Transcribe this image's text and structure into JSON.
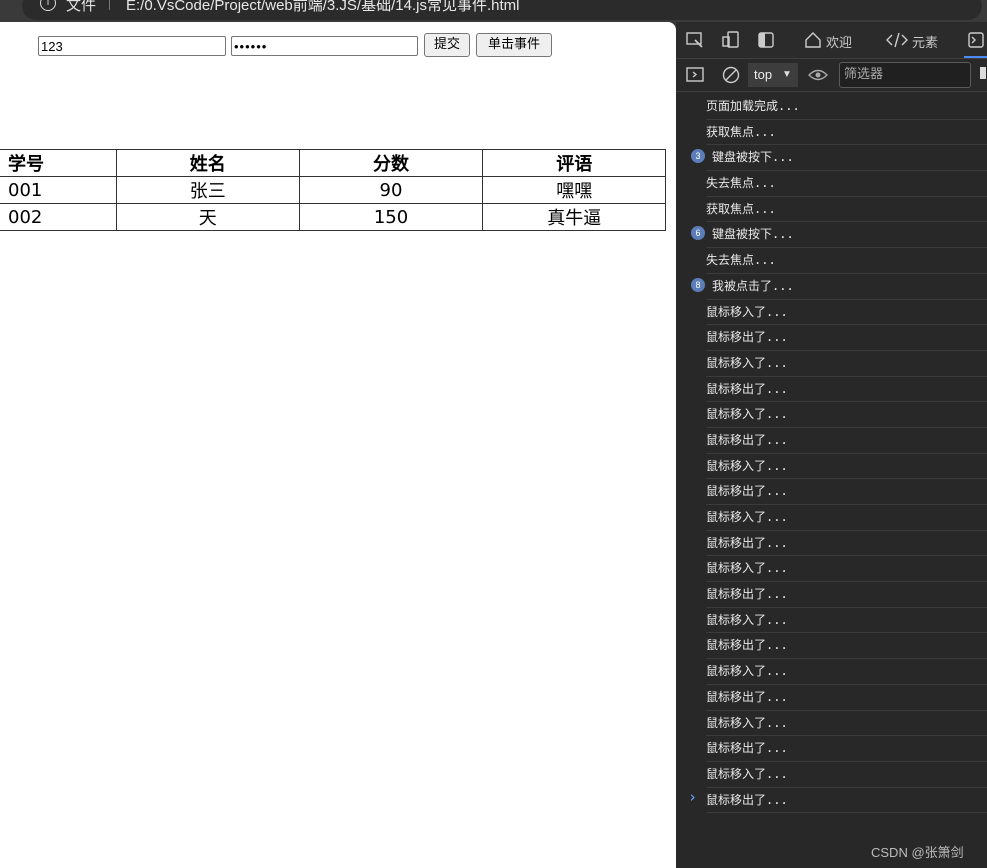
{
  "addressbar": {
    "info_icon": "i",
    "file_label": "文件",
    "url": "E:/0.VsCode/Project/web前端/3.JS/基础/14.js常见事件.html"
  },
  "page": {
    "username_value": "123",
    "password_value": "••••••",
    "submit_label": "提交",
    "click_label": "单击事件",
    "table": {
      "headers": [
        "学号",
        "姓名",
        "分数",
        "评语"
      ],
      "rows": [
        [
          "001",
          "张三",
          "90",
          "嘿嘿"
        ],
        [
          "002",
          "天",
          "150",
          "真牛逼"
        ]
      ]
    }
  },
  "devtools": {
    "tabs": {
      "welcome": "欢迎",
      "elements": "元素"
    },
    "context": "top",
    "filter_placeholder": "筛选器",
    "logs": [
      {
        "text": "页面加载完成...",
        "count": ""
      },
      {
        "text": "获取焦点...",
        "count": ""
      },
      {
        "text": "键盘被按下...",
        "count": "3"
      },
      {
        "text": "失去焦点...",
        "count": ""
      },
      {
        "text": "获取焦点...",
        "count": ""
      },
      {
        "text": "键盘被按下...",
        "count": "6"
      },
      {
        "text": "失去焦点...",
        "count": ""
      },
      {
        "text": "我被点击了...",
        "count": "8"
      },
      {
        "text": "鼠标移入了...",
        "count": ""
      },
      {
        "text": "鼠标移出了...",
        "count": ""
      },
      {
        "text": "鼠标移入了...",
        "count": ""
      },
      {
        "text": "鼠标移出了...",
        "count": ""
      },
      {
        "text": "鼠标移入了...",
        "count": ""
      },
      {
        "text": "鼠标移出了...",
        "count": ""
      },
      {
        "text": "鼠标移入了...",
        "count": ""
      },
      {
        "text": "鼠标移出了...",
        "count": ""
      },
      {
        "text": "鼠标移入了...",
        "count": ""
      },
      {
        "text": "鼠标移出了...",
        "count": ""
      },
      {
        "text": "鼠标移入了...",
        "count": ""
      },
      {
        "text": "鼠标移出了...",
        "count": ""
      },
      {
        "text": "鼠标移入了...",
        "count": ""
      },
      {
        "text": "鼠标移出了...",
        "count": ""
      },
      {
        "text": "鼠标移入了...",
        "count": ""
      },
      {
        "text": "鼠标移出了...",
        "count": ""
      },
      {
        "text": "鼠标移入了...",
        "count": ""
      },
      {
        "text": "鼠标移出了...",
        "count": ""
      },
      {
        "text": "鼠标移入了...",
        "count": ""
      },
      {
        "text": "鼠标移出了...",
        "count": ""
      }
    ],
    "prompt": "›",
    "watermark": "CSDN @张箫剑"
  }
}
